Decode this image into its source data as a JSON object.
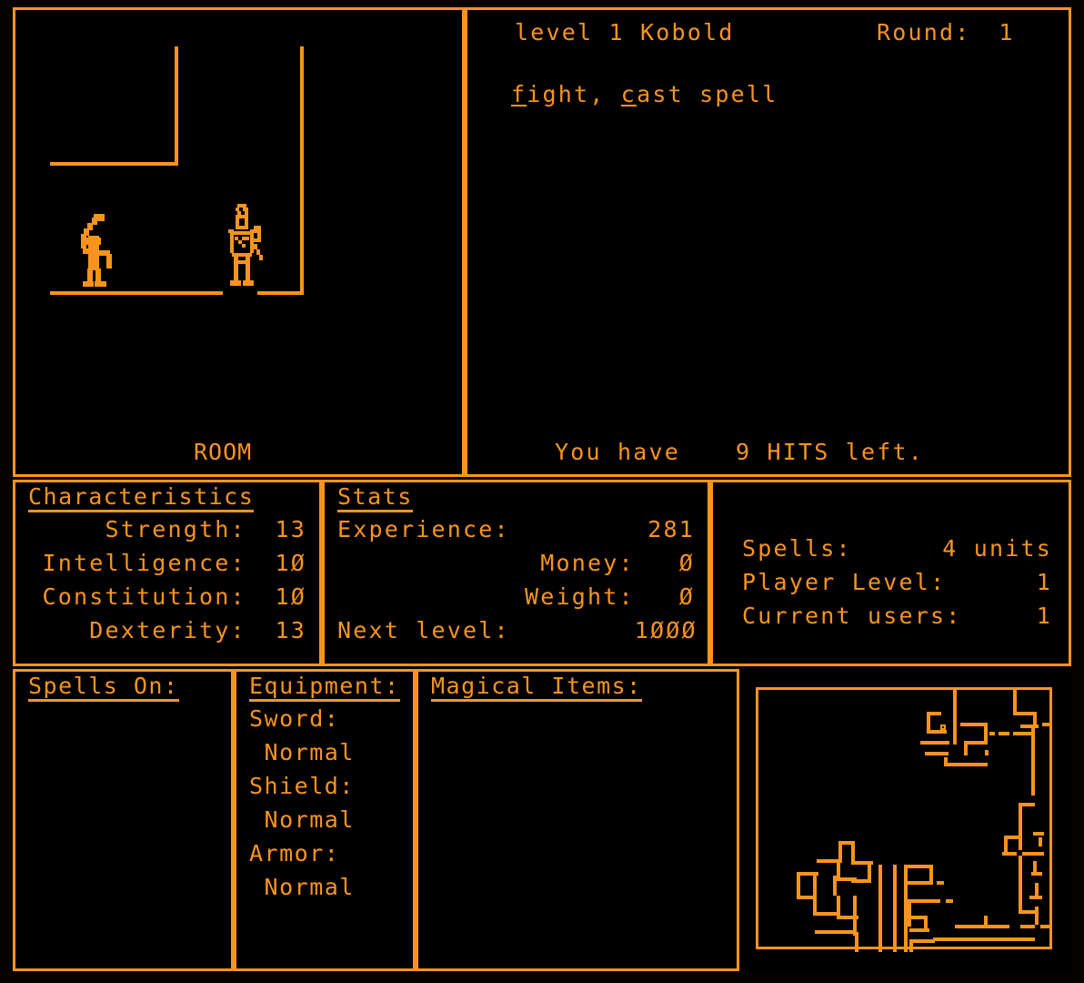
{
  "theme": {
    "amber": "#F8941E",
    "background": "#000000"
  },
  "room_view": {
    "label": "ROOM",
    "figures": [
      {
        "name": "kobold-figure",
        "desc": "small creature with raised club"
      },
      {
        "name": "knight-figure",
        "desc": "armored player knight"
      }
    ]
  },
  "message_panel": {
    "enemy": "level 1 Kobold",
    "round_label": "Round:",
    "round_value": "1",
    "actions_prefix": "",
    "action_fight_key": "f",
    "action_fight_rest": "ight,",
    "action_cast_key": "c",
    "action_cast_rest": "ast spell",
    "hits_prefix": "You have",
    "hits_value": "9",
    "hits_suffix": "HITS left."
  },
  "characteristics": {
    "title": "Characteristics",
    "rows": [
      {
        "key": "Strength:",
        "value": "13"
      },
      {
        "key": "Intelligence:",
        "value": "1Ø"
      },
      {
        "key": "Constitution:",
        "value": "1Ø"
      },
      {
        "key": "Dexterity:",
        "value": "13"
      }
    ]
  },
  "stats": {
    "title": "Stats",
    "rows": [
      {
        "key": "Experience:",
        "value": "281"
      },
      {
        "key": "Money:",
        "value": "Ø"
      },
      {
        "key": "Weight:",
        "value": "Ø"
      },
      {
        "key": "Next level:",
        "value": "1ØØØ"
      }
    ]
  },
  "meta": {
    "rows": [
      {
        "key": "Spells:",
        "value": "4 units"
      },
      {
        "key": "Player Level:",
        "value": "1"
      },
      {
        "key": "Current users:",
        "value": "1"
      }
    ]
  },
  "spells_on": {
    "title": "Spells On:",
    "items": []
  },
  "equipment": {
    "title": "Equipment:",
    "lines": [
      "Sword:",
      " Normal",
      "Shield:",
      " Normal",
      "Armor:",
      " Normal"
    ]
  },
  "magical_items": {
    "title": "Magical Items:",
    "items": []
  },
  "minimap": {
    "name": "dungeon-minimap",
    "player_marker": "current-position-dot"
  }
}
